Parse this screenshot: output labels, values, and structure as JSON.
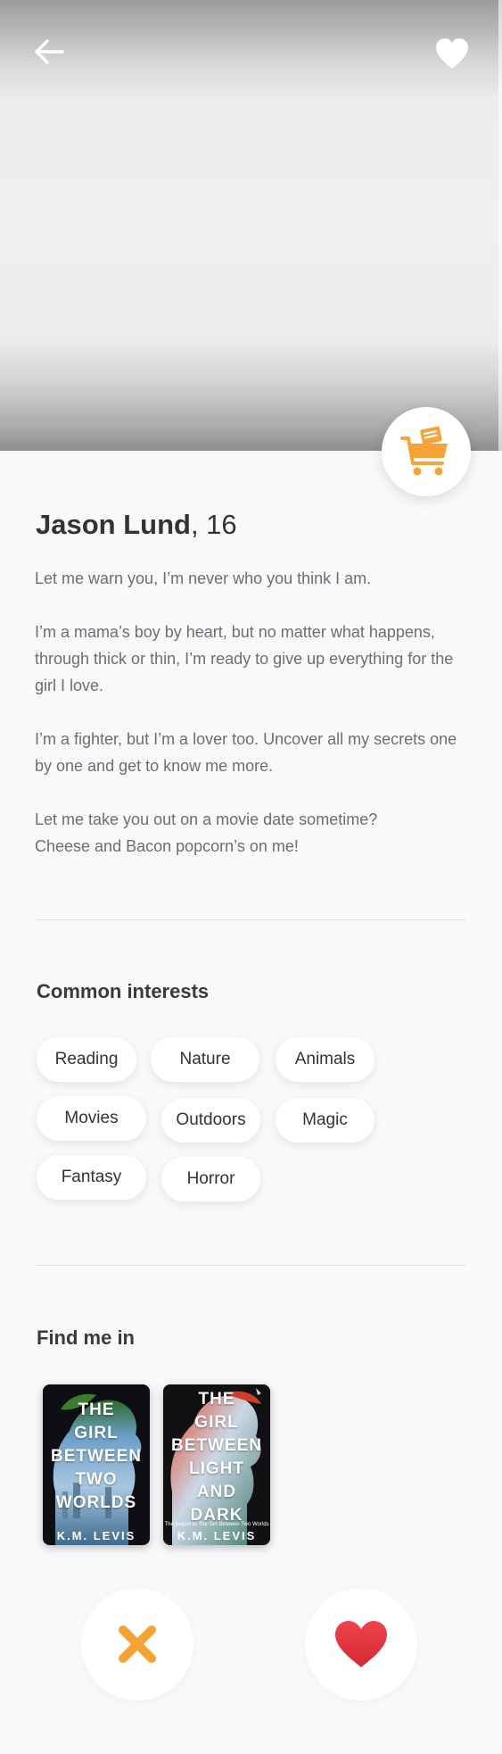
{
  "profile": {
    "name": "Jason Lund",
    "age_suffix": ", 16",
    "bio": [
      "Let me warn you, I’m never who you think I am.",
      "I’m a mama’s boy by heart, but no matter what happens, through thick or thin, I’m ready to give up everything for the girl I love.",
      "I’m a fighter, but I’m a lover too. Uncover all my secrets one by one and get to know me more.",
      "Let me take you out on a movie date sometime?\nCheese and Bacon popcorn’s on me!"
    ]
  },
  "icons": {
    "back": "arrow-left-icon",
    "favorite": "heart-icon",
    "cart": "shopping-cart-icon",
    "reject": "x-icon",
    "like": "heart-icon"
  },
  "interests": {
    "title": "Common interests",
    "items": [
      "Reading",
      "Nature",
      "Animals",
      "Movies",
      "Outdoors",
      "Magic",
      "Fantasy",
      "Horror"
    ]
  },
  "find_me": {
    "title": "Find me in",
    "books": [
      {
        "title": "THE\nGIRL\nBETWEEN\nTWO\nWORLDS",
        "author": "K.M. LEVIS",
        "subtitle": ""
      },
      {
        "title": "THE\nGIRL\nBETWEEN\nLIGHT\nAND\nDARK",
        "author": "K.M. LEVIS",
        "subtitle": "The sequel to The Girl Between Two Worlds"
      }
    ]
  },
  "colors": {
    "accent_orange": "#f7a235",
    "like_red": "#e8333a",
    "background": "#f9f9fb",
    "text_primary": "#333333",
    "text_secondary": "#6e6e72"
  }
}
